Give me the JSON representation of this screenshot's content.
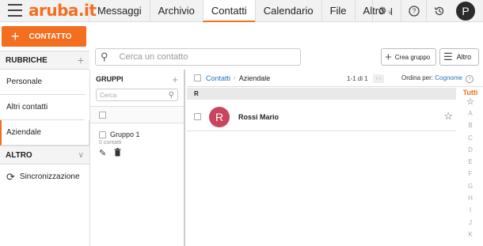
{
  "topbar": {
    "logo": "aruba.it",
    "tabs": [
      {
        "label": "Messaggi"
      },
      {
        "label": "Archivio"
      },
      {
        "label": "Contatti"
      },
      {
        "label": "Calendario"
      },
      {
        "label": "File"
      },
      {
        "label": "Altro"
      }
    ],
    "active_tab": "Contatti",
    "settings_suffix": "I",
    "help_glyph": "?",
    "user_initial": "P"
  },
  "sidebar": {
    "new_contact_label": "CONTATTO",
    "rubriche_header": "RUBRICHE",
    "items": [
      {
        "label": "Personale"
      },
      {
        "label": "Altri contatti"
      },
      {
        "label": "Aziendale"
      }
    ],
    "active_item": "Aziendale",
    "altro_header": "ALTRO",
    "sync_label": "Sincronizzazione"
  },
  "search": {
    "placeholder": "Cerca un contatto"
  },
  "toolbar": {
    "create_group_label": "Crea gruppo",
    "more_label": "Altro"
  },
  "groups": {
    "header": "GRUPPI",
    "search_placeholder": "Cerca",
    "items": [
      {
        "name": "Gruppo 1",
        "count": "0 contatti"
      }
    ]
  },
  "contacts": {
    "breadcrumb_root": "Contatti",
    "breadcrumb_current": "Aziendale",
    "pagination": "1-1 di 1",
    "sort_label": "Ordina per:",
    "sort_value": "Cognome",
    "section_letter": "R",
    "rows": [
      {
        "initial": "R",
        "name": "Rossi Mario",
        "avatar_color": "#c8455d"
      }
    ],
    "alphabet_all": "Tutti",
    "alphabet": [
      "A",
      "B",
      "C",
      "D",
      "E",
      "F",
      "G",
      "H",
      "I",
      "J",
      "K"
    ]
  },
  "colors": {
    "accent": "#f36e1f",
    "link": "#2a73b8"
  }
}
